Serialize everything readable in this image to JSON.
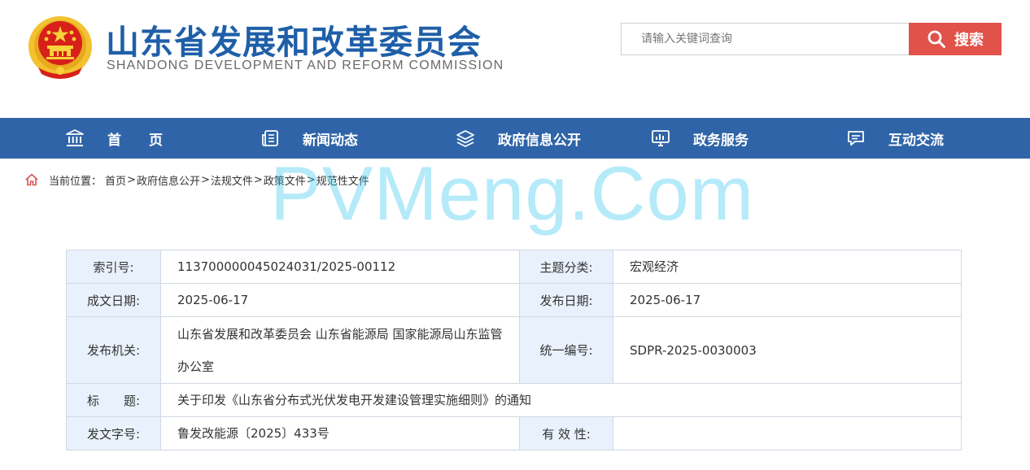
{
  "header": {
    "title": "山东省发展和改革委员会",
    "subtitle": "SHANDONG DEVELOPMENT AND REFORM COMMISSION",
    "search_placeholder": "请输入关键词查询",
    "search_button": "搜索"
  },
  "nav": {
    "items": [
      {
        "label": "首　　页",
        "icon": "building-icon"
      },
      {
        "label": "新闻动态",
        "icon": "news-icon"
      },
      {
        "label": "政府信息公开",
        "icon": "layers-icon"
      },
      {
        "label": "政务服务",
        "icon": "monitor-chart-icon"
      },
      {
        "label": "互动交流",
        "icon": "chat-icon"
      }
    ]
  },
  "breadcrumb": {
    "prefix": "当前位置：",
    "items": [
      "首页",
      "政府信息公开",
      "法规文件",
      "政策文件",
      "规范性文件"
    ],
    "separator": ">"
  },
  "watermark": "PVMeng.Com",
  "meta": {
    "index_label": "索引号:",
    "index_value": "113700000045024031/2025-00112",
    "topic_label": "主题分类:",
    "topic_value": "宏观经济",
    "written_date_label": "成文日期:",
    "written_date_value": "2025-06-17",
    "publish_date_label": "发布日期:",
    "publish_date_value": "2025-06-17",
    "issuer_label": "发布机关:",
    "issuer_value": "山东省发展和改革委员会 山东省能源局 国家能源局山东监管办公室",
    "serial_label": "统一编号:",
    "serial_value": "SDPR-2025-0030003",
    "title_label": "标　　题:",
    "title_value": "关于印发《山东省分布式光伏发电开发建设管理实施细则》的通知",
    "doc_no_label": "发文字号:",
    "doc_no_value": "鲁发改能源〔2025〕433号",
    "validity_label": "有 效 性:",
    "validity_value": ""
  },
  "colors": {
    "brand_blue": "#1f5fa8",
    "nav_blue": "#2f65a8",
    "search_red": "#e0524a",
    "label_cell_bg": "#e9f2fc",
    "emblem_red": "#d7201a",
    "emblem_gold": "#f2c230"
  }
}
